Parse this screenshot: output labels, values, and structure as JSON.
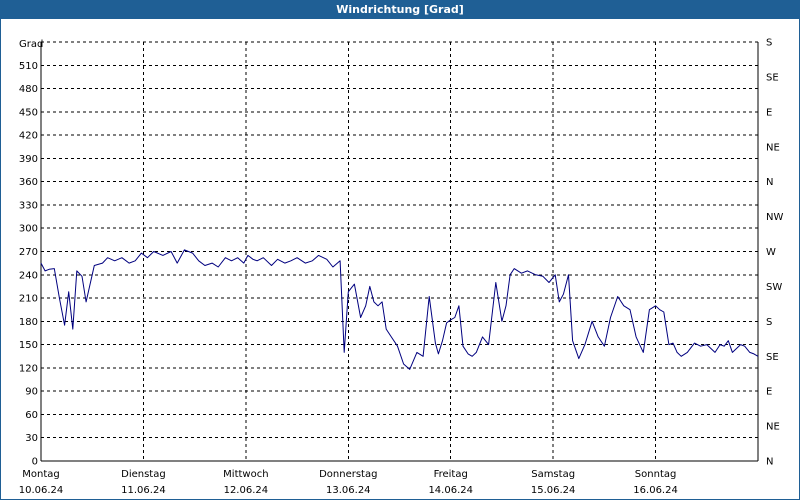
{
  "window": {
    "title": "Windrichtung [Grad]"
  },
  "chart_data": {
    "type": "line",
    "title": "Windrichtung [Grad]",
    "ylabel": "Grad",
    "ylim": [
      0,
      540
    ],
    "y_ticks": [
      0,
      30,
      60,
      90,
      120,
      150,
      180,
      210,
      240,
      270,
      300,
      330,
      360,
      390,
      420,
      450,
      480,
      510
    ],
    "y2_ticks": [
      "N",
      "NE",
      "E",
      "SE",
      "S",
      "SW",
      "W",
      "NW",
      "N",
      "NE",
      "E",
      "SE",
      "S"
    ],
    "x_range_days": [
      0,
      7
    ],
    "x_ticks": [
      {
        "day": "Montag",
        "date": "10.06.24"
      },
      {
        "day": "Dienstag",
        "date": "11.06.24"
      },
      {
        "day": "Mittwoch",
        "date": "12.06.24"
      },
      {
        "day": "Donnerstag",
        "date": "13.06.24"
      },
      {
        "day": "Freitag",
        "date": "14.06.24"
      },
      {
        "day": "Samstag",
        "date": "15.06.24"
      },
      {
        "day": "Sonntag",
        "date": "16.06.24"
      }
    ],
    "grid": true,
    "line_color": "#00007f",
    "series": [
      {
        "x": [
          0,
          0.04,
          0.08,
          0.13,
          0.18,
          0.23,
          0.27,
          0.31,
          0.35,
          0.4,
          0.44,
          0.52,
          0.6,
          0.65,
          0.72,
          0.79,
          0.86,
          0.92,
          0.98,
          1.04,
          1.1,
          1.19,
          1.27,
          1.33,
          1.4,
          1.48,
          1.54,
          1.6,
          1.67,
          1.73,
          1.8,
          1.86,
          1.92,
          1.98,
          2.02,
          2.07,
          2.11,
          2.17,
          2.25,
          2.31,
          2.38,
          2.44,
          2.5,
          2.58,
          2.65,
          2.71,
          2.79,
          2.85,
          2.92,
          2.96,
          3.0,
          3.06,
          3.12,
          3.17,
          3.21,
          3.25,
          3.29,
          3.33,
          3.37,
          3.42,
          3.48,
          3.54,
          3.6,
          3.67,
          3.73,
          3.79,
          3.85,
          3.88,
          3.92,
          3.96,
          4.0,
          4.04,
          4.08,
          4.12,
          4.17,
          4.21,
          4.25,
          4.31,
          4.37,
          4.44,
          4.5,
          4.54,
          4.58,
          4.62,
          4.69,
          4.75,
          4.83,
          4.9,
          4.96,
          5.02,
          5.06,
          5.1,
          5.15,
          5.19,
          5.25,
          5.31,
          5.38,
          5.44,
          5.5,
          5.56,
          5.63,
          5.69,
          5.75,
          5.81,
          5.88,
          5.94,
          6.0,
          6.04,
          6.08,
          6.13,
          6.17,
          6.21,
          6.25,
          6.31,
          6.38,
          6.44,
          6.5,
          6.54,
          6.58,
          6.63,
          6.67,
          6.71,
          6.75,
          6.79,
          6.83,
          6.87,
          6.92,
          6.96,
          7.0
        ],
        "y": [
          255,
          245,
          247,
          248,
          210,
          175,
          218,
          170,
          245,
          238,
          205,
          252,
          255,
          262,
          258,
          262,
          255,
          258,
          268,
          262,
          270,
          265,
          270,
          255,
          272,
          268,
          258,
          252,
          255,
          250,
          262,
          258,
          262,
          255,
          265,
          260,
          258,
          262,
          252,
          260,
          255,
          258,
          262,
          255,
          258,
          265,
          260,
          250,
          258,
          140,
          218,
          228,
          185,
          200,
          225,
          205,
          200,
          205,
          170,
          160,
          148,
          125,
          118,
          140,
          135,
          212,
          152,
          138,
          155,
          178,
          182,
          185,
          200,
          148,
          138,
          135,
          140,
          160,
          150,
          230,
          180,
          200,
          240,
          248,
          242,
          245,
          240,
          238,
          230,
          240,
          205,
          215,
          240,
          155,
          132,
          150,
          180,
          160,
          148,
          185,
          212,
          200,
          195,
          160,
          140,
          195,
          200,
          195,
          192,
          150,
          152,
          140,
          135,
          140,
          152,
          148,
          150,
          145,
          140,
          150,
          148,
          155,
          140,
          145,
          150,
          148,
          140,
          138,
          135
        ]
      }
    ]
  }
}
